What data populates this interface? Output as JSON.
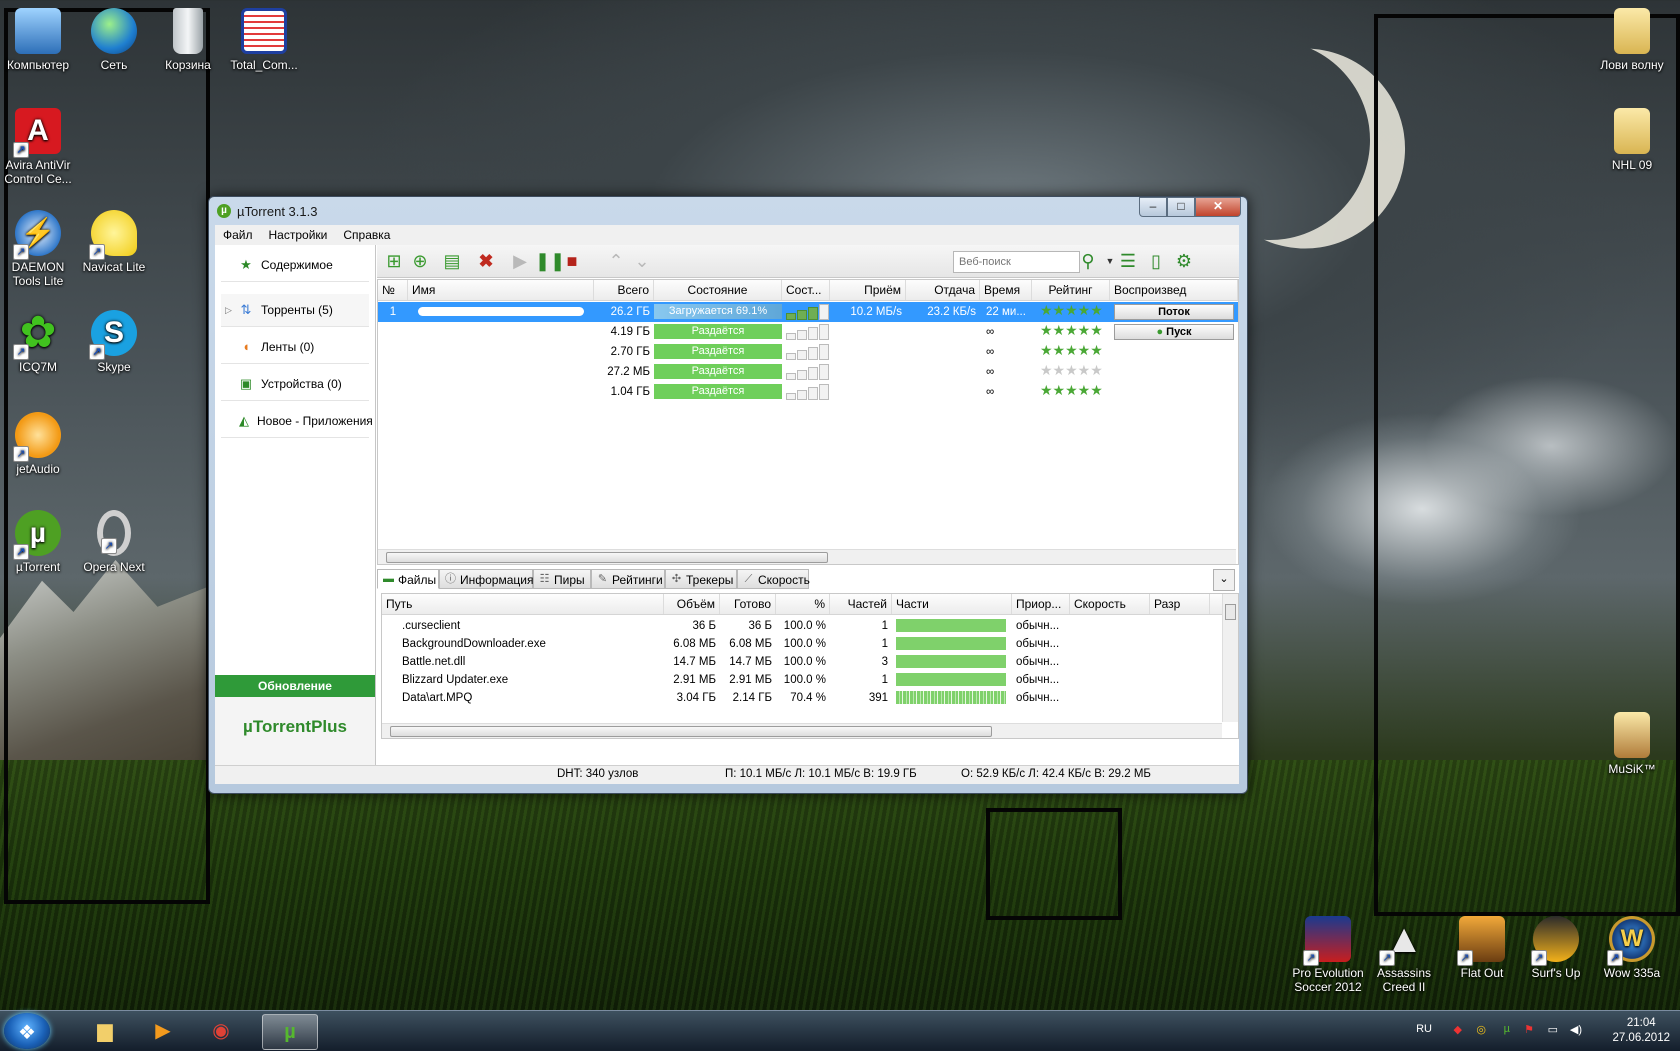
{
  "desktop": {
    "icons_left": [
      {
        "label": "Компьютер",
        "icon": "computer-icon"
      },
      {
        "label": "Сеть",
        "icon": "network-icon"
      },
      {
        "label": "Корзина",
        "icon": "recycle-bin-icon"
      },
      {
        "label": "Total_Com...",
        "icon": "floppy-icon"
      },
      {
        "label": "Avira AntiVir Control Ce...",
        "icon": "avira-icon"
      },
      {
        "label": "DAEMON Tools Lite",
        "icon": "daemon-tools-icon"
      },
      {
        "label": "Navicat Lite",
        "icon": "navicat-icon"
      },
      {
        "label": "ICQ7M",
        "icon": "icq-icon"
      },
      {
        "label": "Skype",
        "icon": "skype-icon"
      },
      {
        "label": "jetAudio",
        "icon": "jetaudio-icon"
      },
      {
        "label": "µTorrent",
        "icon": "utorrent-icon"
      },
      {
        "label": "Opera Next",
        "icon": "opera-icon"
      }
    ],
    "icons_right": [
      {
        "label": "Лови волну",
        "icon": "folder-icon"
      },
      {
        "label": "NHL 09",
        "icon": "folder-icon"
      },
      {
        "label": "MuSiK™",
        "icon": "folder-icon"
      }
    ],
    "icons_bottom": [
      {
        "label": "Pro Evolution Soccer 2012",
        "icon": "pes-icon"
      },
      {
        "label": "Assassins Creed II",
        "icon": "assassins-creed-icon"
      },
      {
        "label": "Flat Out",
        "icon": "flatout-icon"
      },
      {
        "label": "Surf's Up",
        "icon": "surfsup-icon"
      },
      {
        "label": "Wow 335a",
        "icon": "wow-icon"
      }
    ]
  },
  "window": {
    "title": "µTorrent 3.1.3",
    "controls": {
      "minimize": "‒",
      "maximize": "□",
      "close": "✕"
    },
    "menu": [
      "Файл",
      "Настройки",
      "Справка"
    ],
    "sidebar": {
      "items": [
        {
          "label": "Содержимое",
          "icon": "star-icon"
        },
        {
          "label": "Торренты (5)",
          "icon": "torrents-icon"
        },
        {
          "label": "Ленты (0)",
          "icon": "rss-icon"
        },
        {
          "label": "Устройства (0)",
          "icon": "devices-icon"
        },
        {
          "label": "Новое - Приложения",
          "icon": "apps-icon"
        }
      ],
      "update_label": "Обновление",
      "plus_label": "µTorrentPlus"
    },
    "toolbar": {
      "search_placeholder": "Веб-поиск"
    },
    "torrent_columns": [
      "№",
      "Имя",
      "Всего",
      "Состояние",
      "Сост...",
      "Приём",
      "Отдача",
      "Время",
      "Рейтинг",
      "Воспроизвед"
    ],
    "torrents": [
      {
        "num": "1",
        "name": "",
        "size": "26.2 ГБ",
        "status": "Загружается 69.1%",
        "progress": 69.1,
        "down": "10.2 МБ/s",
        "up": "23.2 КБ/s",
        "eta": "22 ми...",
        "rating": 5,
        "play": "Поток",
        "selected": true
      },
      {
        "num": "",
        "name": "",
        "size": "4.19 ГБ",
        "status": "Раздаётся",
        "progress": 100,
        "down": "",
        "up": "",
        "eta": "∞",
        "rating": 5,
        "play": "Пуск",
        "selected": false
      },
      {
        "num": "",
        "name": "",
        "size": "2.70 ГБ",
        "status": "Раздаётся",
        "progress": 100,
        "down": "",
        "up": "",
        "eta": "∞",
        "rating": 5,
        "play": "",
        "selected": false
      },
      {
        "num": "",
        "name": "",
        "size": "27.2 МБ",
        "status": "Раздаётся",
        "progress": 100,
        "down": "",
        "up": "",
        "eta": "∞",
        "rating": 0,
        "play": "",
        "selected": false
      },
      {
        "num": "",
        "name": "",
        "size": "1.04 ГБ",
        "status": "Раздаётся",
        "progress": 100,
        "down": "",
        "up": "",
        "eta": "∞",
        "rating": 5,
        "play": "",
        "selected": false
      }
    ],
    "tabs": [
      {
        "label": "Файлы",
        "icon": "files-icon"
      },
      {
        "label": "Информация",
        "icon": "info-icon"
      },
      {
        "label": "Пиры",
        "icon": "peers-icon"
      },
      {
        "label": "Рейтинги",
        "icon": "ratings-icon"
      },
      {
        "label": "Трекеры",
        "icon": "trackers-icon"
      },
      {
        "label": "Скорость",
        "icon": "speed-icon"
      }
    ],
    "file_columns": [
      "Путь",
      "Объём",
      "Готово",
      "%",
      "Частей",
      "Части",
      "Приор...",
      "Скорость",
      "Разр"
    ],
    "files": [
      {
        "path": ".curseclient",
        "size": "36 Б",
        "done": "36 Б",
        "pct": "100.0 %",
        "pieces": "1",
        "priority": "обычн...",
        "complete": 1.0
      },
      {
        "path": "BackgroundDownloader.exe",
        "size": "6.08 МБ",
        "done": "6.08 МБ",
        "pct": "100.0 %",
        "pieces": "1",
        "priority": "обычн...",
        "complete": 1.0
      },
      {
        "path": "Battle.net.dll",
        "size": "14.7 МБ",
        "done": "14.7 МБ",
        "pct": "100.0 %",
        "pieces": "3",
        "priority": "обычн...",
        "complete": 1.0
      },
      {
        "path": "Blizzard Updater.exe",
        "size": "2.91 МБ",
        "done": "2.91 МБ",
        "pct": "100.0 %",
        "pieces": "1",
        "priority": "обычн...",
        "complete": 1.0
      },
      {
        "path": "Data\\art.MPQ",
        "size": "3.04 ГБ",
        "done": "2.14 ГБ",
        "pct": "70.4 %",
        "pieces": "391",
        "priority": "обычн...",
        "complete": 0.704
      }
    ],
    "statusbar": {
      "dht": "DHT: 340 узлов",
      "download": "П: 10.1 МБ/с Л: 10.1 МБ/с В: 19.9 ГБ",
      "upload": "О: 52.9 КБ/с Л: 42.4 КБ/с В: 29.2 МБ"
    }
  },
  "taskbar": {
    "language": "RU",
    "time": "21:04",
    "date": "27.06.2012",
    "pinned": [
      "explorer-icon",
      "media-player-icon",
      "chrome-icon",
      "utorrent-icon"
    ]
  }
}
